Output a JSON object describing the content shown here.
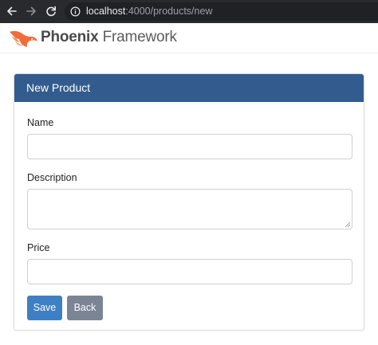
{
  "browser": {
    "url_host": "localhost",
    "url_path": ":4000/products/new"
  },
  "header": {
    "brand_bold": "Phoenix",
    "brand_light": "Framework"
  },
  "form": {
    "title": "New Product",
    "fields": [
      {
        "label": "Name",
        "value": "",
        "placeholder": ""
      },
      {
        "label": "Description",
        "value": "",
        "placeholder": ""
      },
      {
        "label": "Price",
        "value": "",
        "placeholder": ""
      }
    ],
    "save_label": "Save",
    "back_label": "Back"
  },
  "colors": {
    "panel_heading": "#335c8e",
    "save_button": "#3f7fc4",
    "back_button": "#7a8494",
    "logo": "#f26b3a"
  }
}
